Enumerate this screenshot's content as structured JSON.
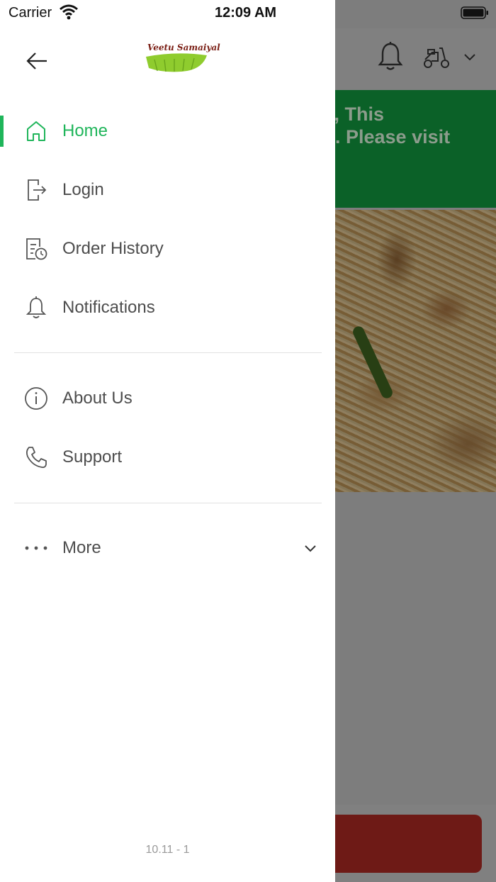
{
  "status_bar": {
    "carrier": "Carrier",
    "time": "12:09 AM"
  },
  "drawer": {
    "logo_text": "Veetu Samaiyal",
    "menu": [
      {
        "label": "Home",
        "icon": "home-icon",
        "active": true
      },
      {
        "label": "Login",
        "icon": "login-icon",
        "active": false
      },
      {
        "label": "Order History",
        "icon": "order-history-icon",
        "active": false
      },
      {
        "label": "Notifications",
        "icon": "bell-icon",
        "active": false
      },
      {
        "label": "About Us",
        "icon": "info-icon",
        "active": false
      },
      {
        "label": "Support",
        "icon": "phone-icon",
        "active": false
      },
      {
        "label": "More",
        "icon": "more-dots-icon",
        "active": false
      }
    ],
    "version": "10.11 - 1"
  },
  "background": {
    "banner_text": "ed, This\non. Please visit\ny"
  },
  "colors": {
    "accent": "#1fb55a",
    "banner": "#0b6128",
    "text": "#4d4d4d",
    "bottom_button": "#6e1a16"
  }
}
